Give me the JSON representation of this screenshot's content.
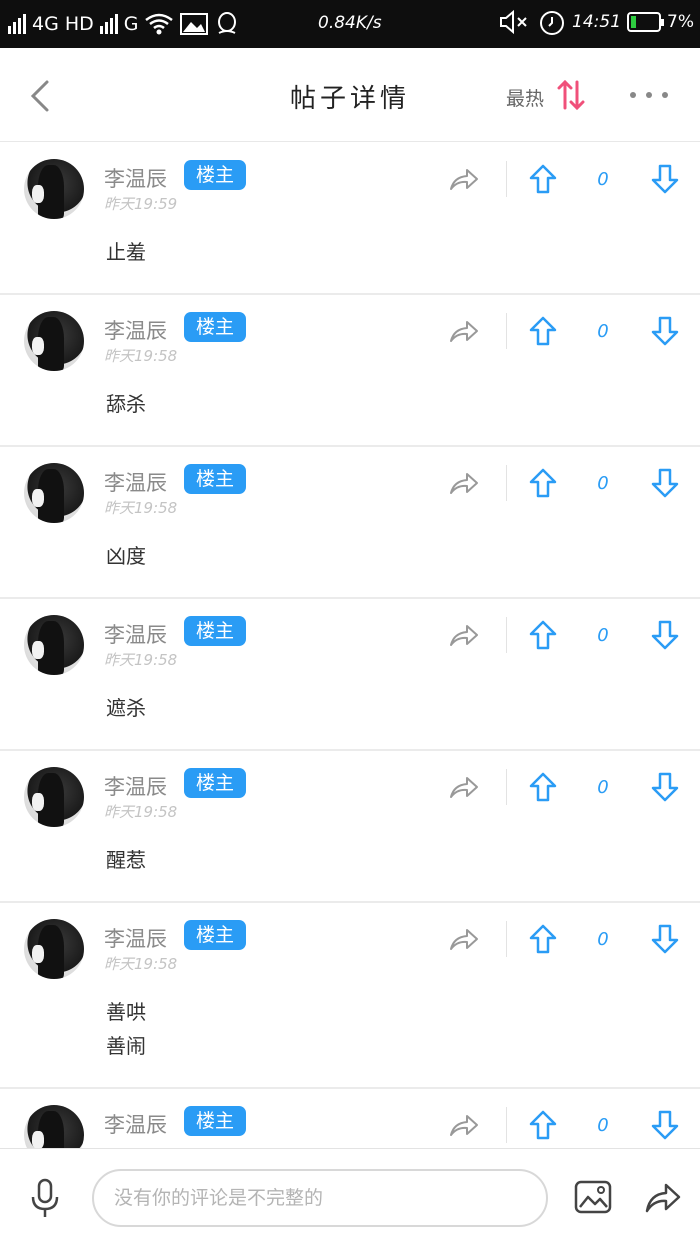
{
  "status_bar": {
    "network": "4G",
    "hd": "HD",
    "g": "G",
    "speed": "0.84K/s",
    "time": "14:51",
    "battery": "7%"
  },
  "header": {
    "title": "帖子详情",
    "sort_label": "最热"
  },
  "colors": {
    "accent": "#2a9cf5",
    "sort_icon": "#f0507a",
    "status_bar_bg": "#0e0e0e"
  },
  "posts": [
    {
      "name": "李温辰",
      "badge": "楼主",
      "time": "昨天19:59",
      "lines": [
        "止羞"
      ],
      "votes": "0"
    },
    {
      "name": "李温辰",
      "badge": "楼主",
      "time": "昨天19:58",
      "lines": [
        "舔杀"
      ],
      "votes": "0"
    },
    {
      "name": "李温辰",
      "badge": "楼主",
      "time": "昨天19:58",
      "lines": [
        "凶度"
      ],
      "votes": "0"
    },
    {
      "name": "李温辰",
      "badge": "楼主",
      "time": "昨天19:58",
      "lines": [
        "遮杀"
      ],
      "votes": "0"
    },
    {
      "name": "李温辰",
      "badge": "楼主",
      "time": "昨天19:58",
      "lines": [
        "醒惹"
      ],
      "votes": "0"
    },
    {
      "name": "李温辰",
      "badge": "楼主",
      "time": "昨天19:58",
      "lines": [
        "善哄",
        "善闹"
      ],
      "votes": "0"
    },
    {
      "name": "李温辰",
      "badge": "楼主",
      "time": "",
      "lines": [],
      "votes": "0"
    }
  ],
  "bottom_bar": {
    "placeholder": "没有你的评论是不完整的"
  }
}
